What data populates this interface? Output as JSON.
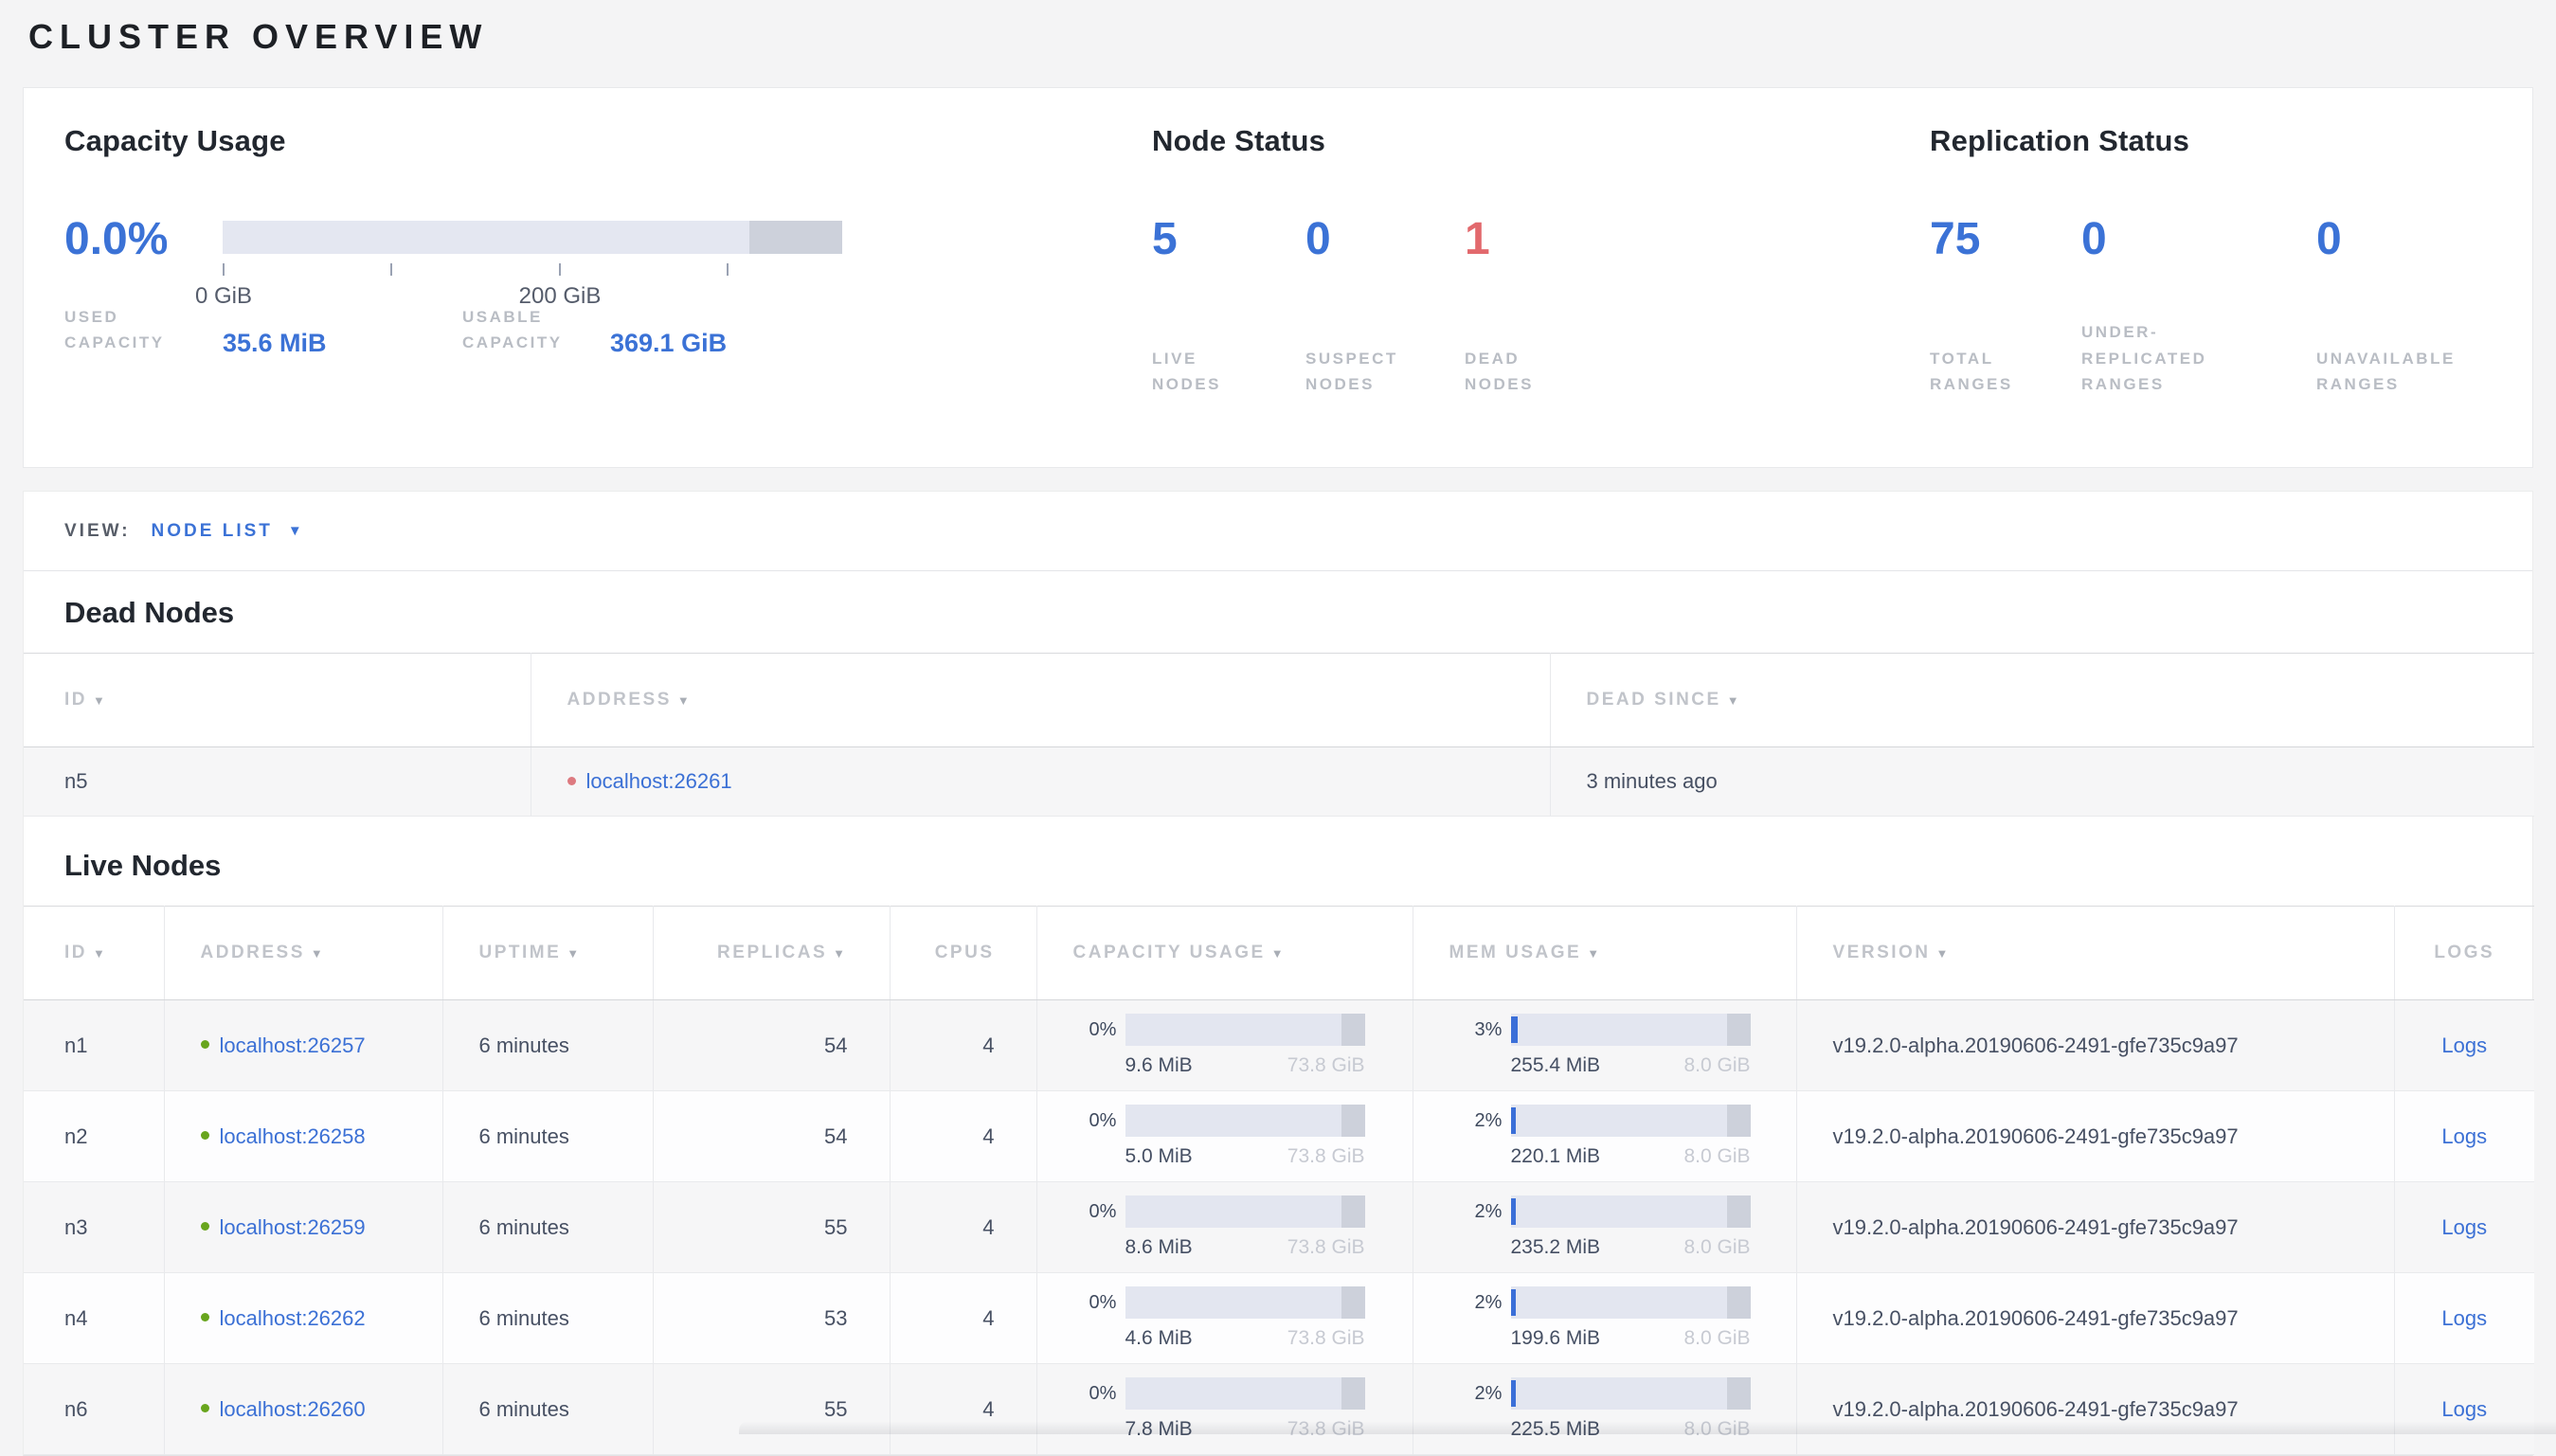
{
  "page_title": "CLUSTER OVERVIEW",
  "icons": {
    "sort": "▼",
    "caret": "▼"
  },
  "colors": {
    "accent_blue": "#3b72d6",
    "dead_red": "#e2696d",
    "live_dot_green": "#68a51d",
    "dead_dot_red": "#dd7a80",
    "bar_track": "#e3e6f0",
    "bar_end_segment": "#cdd1db"
  },
  "summary": {
    "capacity": {
      "title": "Capacity Usage",
      "percent": "0.0%",
      "fill_pct": 0,
      "tick_label_0": "0 GiB",
      "tick_label_200": "200 GiB",
      "used_label": "USED\nCAPACITY",
      "used_value": "35.6 MiB",
      "usable_label": "USABLE\nCAPACITY",
      "usable_value": "369.1 GiB"
    },
    "node_status": {
      "title": "Node Status",
      "stats": [
        {
          "value": "5",
          "label": "LIVE\nNODES"
        },
        {
          "value": "0",
          "label": "SUSPECT\nNODES"
        },
        {
          "value": "1",
          "label": "DEAD\nNODES"
        }
      ]
    },
    "replication": {
      "title": "Replication Status",
      "stats": [
        {
          "value": "75",
          "label": "TOTAL\nRANGES"
        },
        {
          "value": "0",
          "label": "UNDER-\nREPLICATED\nRANGES"
        },
        {
          "value": "0",
          "label": "UNAVAILABLE\nRANGES"
        }
      ]
    }
  },
  "view_bar": {
    "label": "VIEW:",
    "selected": "NODE LIST"
  },
  "dead_nodes": {
    "title": "Dead Nodes",
    "columns": {
      "id": "ID",
      "address": "ADDRESS",
      "dead_since": "DEAD SINCE"
    },
    "rows": [
      {
        "id": "n5",
        "address": "localhost:26261",
        "dead_since": "3 minutes ago"
      }
    ]
  },
  "live_nodes": {
    "title": "Live Nodes",
    "columns": {
      "id": "ID",
      "address": "ADDRESS",
      "uptime": "UPTIME",
      "replicas": "REPLICAS",
      "cpus": "CPUS",
      "capacity": "CAPACITY USAGE",
      "memory": "MEM USAGE",
      "version": "VERSION",
      "logs": "LOGS"
    },
    "rows": [
      {
        "id": "n1",
        "address": "localhost:26257",
        "uptime": "6 minutes",
        "replicas": "54",
        "cpus": "4",
        "capacity": {
          "percent": "0%",
          "fill_pct": 0,
          "used": "9.6 MiB",
          "total": "73.8 GiB"
        },
        "memory": {
          "percent": "3%",
          "fill_pct": 3,
          "used": "255.4 MiB",
          "total": "8.0 GiB"
        },
        "version": "v19.2.0-alpha.20190606-2491-gfe735c9a97",
        "logs_label": "Logs"
      },
      {
        "id": "n2",
        "address": "localhost:26258",
        "uptime": "6 minutes",
        "replicas": "54",
        "cpus": "4",
        "capacity": {
          "percent": "0%",
          "fill_pct": 0,
          "used": "5.0 MiB",
          "total": "73.8 GiB"
        },
        "memory": {
          "percent": "2%",
          "fill_pct": 2,
          "used": "220.1 MiB",
          "total": "8.0 GiB"
        },
        "version": "v19.2.0-alpha.20190606-2491-gfe735c9a97",
        "logs_label": "Logs"
      },
      {
        "id": "n3",
        "address": "localhost:26259",
        "uptime": "6 minutes",
        "replicas": "55",
        "cpus": "4",
        "capacity": {
          "percent": "0%",
          "fill_pct": 0,
          "used": "8.6 MiB",
          "total": "73.8 GiB"
        },
        "memory": {
          "percent": "2%",
          "fill_pct": 2,
          "used": "235.2 MiB",
          "total": "8.0 GiB"
        },
        "version": "v19.2.0-alpha.20190606-2491-gfe735c9a97",
        "logs_label": "Logs"
      },
      {
        "id": "n4",
        "address": "localhost:26262",
        "uptime": "6 minutes",
        "replicas": "53",
        "cpus": "4",
        "capacity": {
          "percent": "0%",
          "fill_pct": 0,
          "used": "4.6 MiB",
          "total": "73.8 GiB"
        },
        "memory": {
          "percent": "2%",
          "fill_pct": 2,
          "used": "199.6 MiB",
          "total": "8.0 GiB"
        },
        "version": "v19.2.0-alpha.20190606-2491-gfe735c9a97",
        "logs_label": "Logs"
      },
      {
        "id": "n6",
        "address": "localhost:26260",
        "uptime": "6 minutes",
        "replicas": "55",
        "cpus": "4",
        "capacity": {
          "percent": "0%",
          "fill_pct": 0,
          "used": "7.8 MiB",
          "total": "73.8 GiB"
        },
        "memory": {
          "percent": "2%",
          "fill_pct": 2,
          "used": "225.5 MiB",
          "total": "8.0 GiB"
        },
        "version": "v19.2.0-alpha.20190606-2491-gfe735c9a97",
        "logs_label": "Logs"
      }
    ]
  }
}
